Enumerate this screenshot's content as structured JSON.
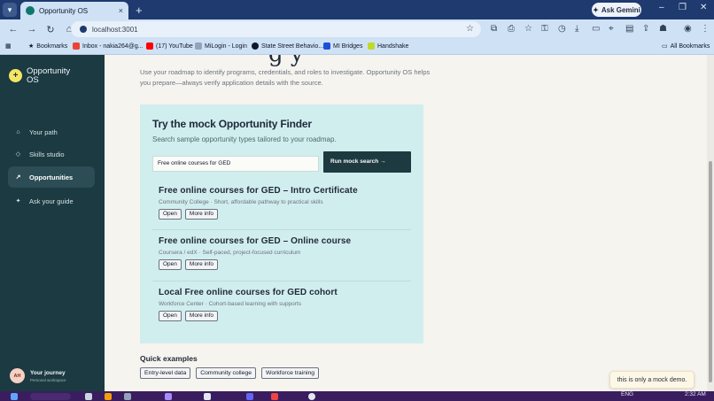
{
  "browser": {
    "tab_title": "Opportunity OS",
    "tab_close": "×",
    "new_tab": "+",
    "gemini_label": "Ask Gemini",
    "window_controls": [
      "–",
      "❐",
      "✕"
    ],
    "url": "localhost:3001",
    "bookmarks": [
      {
        "label": "Bookmarks",
        "icon": "star-icon",
        "color": "#1e293b"
      },
      {
        "label": "Inbox - nakia264@g...",
        "icon": "gmail-icon",
        "color": "#ea4335"
      },
      {
        "label": "(17) YouTube",
        "icon": "youtube-icon",
        "color": "#ff0000"
      },
      {
        "label": "MiLogin - Login",
        "icon": "page-icon",
        "color": "#334155"
      },
      {
        "label": "State Street Behavio...",
        "icon": "globe-icon",
        "color": "#0f172a"
      },
      {
        "label": "MI Bridges",
        "icon": "bridge-icon",
        "color": "#1d4ed8"
      },
      {
        "label": "Handshake",
        "icon": "handshake-icon",
        "color": "#c2d82b"
      }
    ],
    "all_bookmarks": "All Bookmarks"
  },
  "sidebar": {
    "brand_icon": "+",
    "brand_name": "Opportunity OS",
    "items": [
      {
        "label": "Your path",
        "icon": "⌂",
        "active": false
      },
      {
        "label": "Skills studio",
        "icon": "◇",
        "active": false
      },
      {
        "label": "Opportunities",
        "icon": "↗",
        "active": true
      },
      {
        "label": "Ask your guide",
        "icon": "✦",
        "active": false
      }
    ],
    "journey": {
      "avatar": "AH",
      "title": "Your journey",
      "subtitle": "Personal workspace"
    }
  },
  "main": {
    "heading_fragment": "g y",
    "intro": "Use your roadmap to identify programs, credentials, and roles to investigate. Opportunity OS helps you prepare—always verify application details with the source.",
    "finder": {
      "title": "Try the mock Opportunity Finder",
      "subtitle": "Search sample opportunity types tailored to your roadmap.",
      "input_value": "Free online courses for GED",
      "run_button": "Run mock search →",
      "results": [
        {
          "title": "Free online courses for GED – Intro Certificate",
          "meta": "Community College · Short, affordable pathway to practical skills",
          "open": "Open",
          "more": "More info"
        },
        {
          "title": "Free online courses for GED – Online course",
          "meta": "Coursera / edX · Self-paced, project-focused curriculum",
          "open": "Open",
          "more": "More info"
        },
        {
          "title": "Local Free online courses for GED cohort",
          "meta": "Workforce Center · Cohort-based learning with supports",
          "open": "Open",
          "more": "More info"
        }
      ]
    },
    "quick_examples": {
      "title": "Quick examples",
      "chips": [
        "Entry-level data",
        "Community college",
        "Workforce training"
      ]
    },
    "toast": "this is only a mock demo."
  },
  "taskbar": {
    "lang": "ENG",
    "time": "2:32 AM"
  }
}
